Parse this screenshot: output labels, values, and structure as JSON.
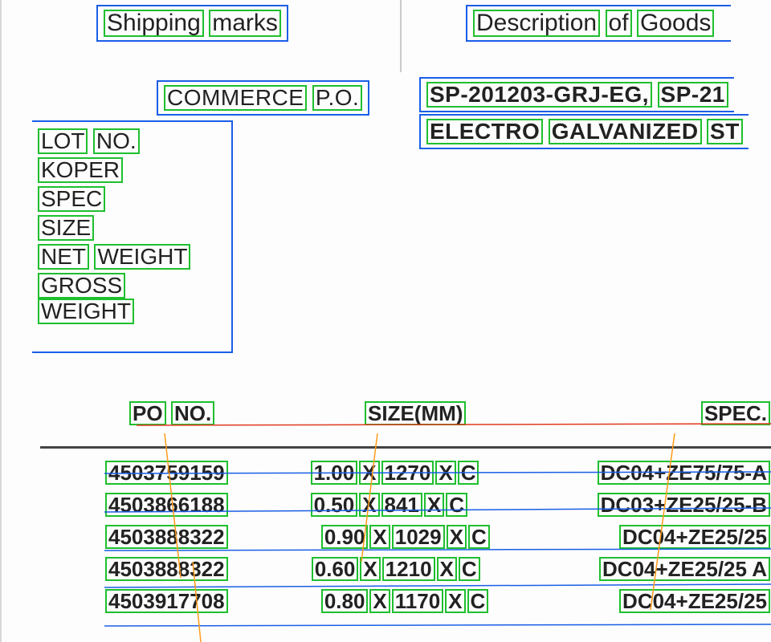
{
  "header": {
    "shipping_marks": "Shipping marks",
    "description_of_goods": "Description of Goods",
    "commerce_po": "COMMERCE P.O.",
    "sp_line": "SP-201203-GRJ-EG, SP-21",
    "product_line": "ELECTRO GALVANIZED ST"
  },
  "labels": {
    "lot_no": "LOT NO.",
    "koper": "KOPER",
    "spec": "SPEC",
    "size": "SIZE",
    "net_weight": "NET WEIGHT",
    "gross_weight": "GROSS WEIGHT"
  },
  "table": {
    "headers": {
      "po_no": "PO NO.",
      "size_mm": "SIZE(MM)",
      "spec": "SPEC."
    },
    "rows": [
      {
        "po_no": "4503759159",
        "size": "1.00 X 1270 X C",
        "spec": "DC04+ZE75/75-A"
      },
      {
        "po_no": "4503866188",
        "size": "0.50 X 841 X C",
        "spec": "DC03+ZE25/25-B"
      },
      {
        "po_no": "4503888322",
        "size": "0.90 X 1029 X C",
        "spec": "DC04+ZE25/25"
      },
      {
        "po_no": "4503888322",
        "size": "0.60 X 1210 X C",
        "spec": "DC04+ZE25/25 A"
      },
      {
        "po_no": "4503917708",
        "size": "0.80 X 1170 X C",
        "spec": "DC04+ZE25/25"
      }
    ]
  }
}
